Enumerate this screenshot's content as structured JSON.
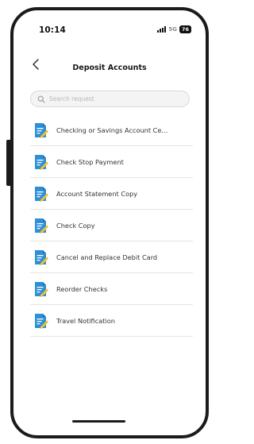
{
  "status_bar": {
    "time": "10:14",
    "network": "5G",
    "battery": "76"
  },
  "header": {
    "title": "Deposit Accounts"
  },
  "search": {
    "placeholder": "Search request",
    "value": ""
  },
  "items": [
    {
      "label": "Checking or Savings Account Ce..."
    },
    {
      "label": "Check Stop Payment"
    },
    {
      "label": "Account Statement Copy"
    },
    {
      "label": "Check Copy"
    },
    {
      "label": "Cancel and Replace Debit Card"
    },
    {
      "label": "Reorder Checks"
    },
    {
      "label": "Travel Notification"
    }
  ],
  "colors": {
    "icon_blue": "#2f8fd6",
    "icon_yellow": "#f2c230"
  }
}
